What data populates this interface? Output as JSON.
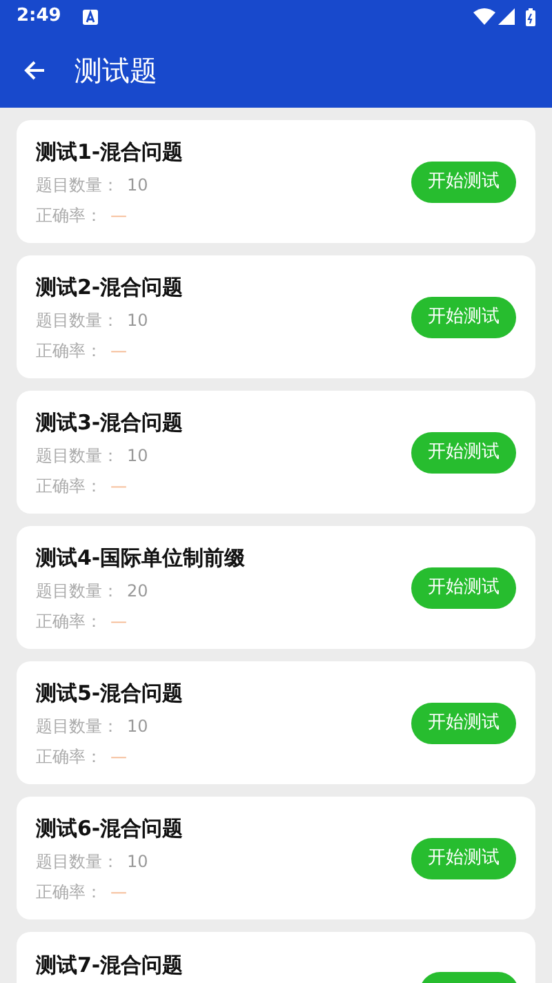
{
  "status_bar": {
    "time": "2:49"
  },
  "app_bar": {
    "title": "测试题"
  },
  "tests": [
    {
      "kind": "full",
      "title": "测试1-混合问题",
      "count_label": "题目数量：",
      "count": "10",
      "accuracy_label": "正确率：",
      "accuracy": "—",
      "button": "开始测试"
    },
    {
      "kind": "full",
      "title": "测试2-混合问题",
      "count_label": "题目数量：",
      "count": "10",
      "accuracy_label": "正确率：",
      "accuracy": "—",
      "button": "开始测试"
    },
    {
      "kind": "full",
      "title": "测试3-混合问题",
      "count_label": "题目数量：",
      "count": "10",
      "accuracy_label": "正确率：",
      "accuracy": "—",
      "button": "开始测试"
    },
    {
      "kind": "full",
      "title": "测试4-国际单位制前缀",
      "count_label": "题目数量：",
      "count": "20",
      "accuracy_label": "正确率：",
      "accuracy": "—",
      "button": "开始测试"
    },
    {
      "kind": "full",
      "title": "测试5-混合问题",
      "count_label": "题目数量：",
      "count": "10",
      "accuracy_label": "正确率：",
      "accuracy": "—",
      "button": "开始测试"
    },
    {
      "kind": "full",
      "title": "测试6-混合问题",
      "count_label": "题目数量：",
      "count": "10",
      "accuracy_label": "正确率：",
      "accuracy": "—",
      "button": "开始测试"
    },
    {
      "kind": "partial",
      "title": "测试7-混合问题"
    }
  ]
}
